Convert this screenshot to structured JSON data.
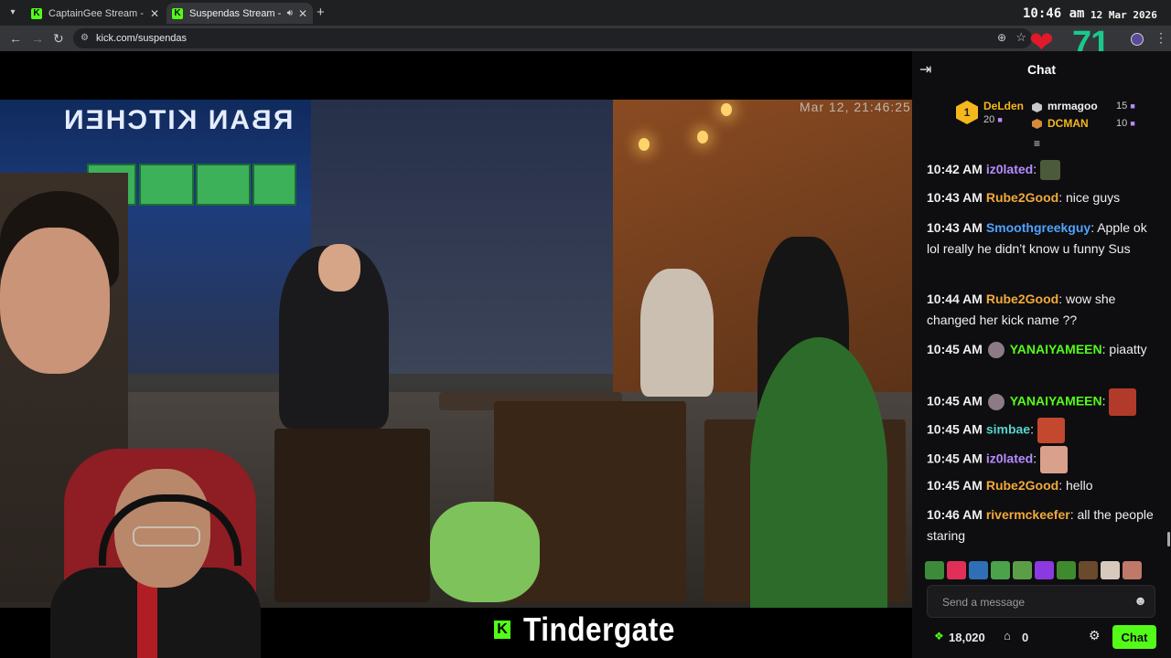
{
  "browser": {
    "tabs": [
      {
        "title": "CaptainGee Stream - Watch Live",
        "active": false
      },
      {
        "title": "Suspendas Stream - Watch Live",
        "active": true
      }
    ],
    "url": "kick.com/suspendas",
    "clock": "10:46 am",
    "date": "12 Mar 2026",
    "heart_value": "71"
  },
  "video": {
    "overlay_timestamp": "Mar 12, 21:46:25",
    "storefront_sign": "RBAN KITCHEN",
    "stream_title": "Tindergate",
    "brand_mark": "K"
  },
  "chat": {
    "title": "Chat",
    "leaderboard": {
      "first": {
        "rank": "1",
        "name": "DeLden",
        "points": "20"
      },
      "second": {
        "name": "mrmagoo",
        "points": "15"
      },
      "third": {
        "name": "DCMAN",
        "points": "10"
      }
    },
    "messages": [
      {
        "time": "10:42 AM",
        "user": "iz0lated",
        "user_color": "#b48cff",
        "text": "",
        "emote": true
      },
      {
        "time": "10:43 AM",
        "user": "Rube2Good",
        "user_color": "#f2a93b",
        "text": "nice guys"
      },
      {
        "time": "10:43 AM",
        "user": "Smoothgreekguy",
        "user_color": "#4ea3ff",
        "text": "Apple ok lol really he didn’t know u funny Sus"
      },
      {
        "time": "10:44 AM",
        "user": "Rube2Good",
        "user_color": "#f2a93b",
        "text": "wow she changed her kick name ??"
      },
      {
        "time": "10:45 AM",
        "user": "YANAIYAMEEN",
        "user_color": "#53fc18",
        "text": "piaatty"
      },
      {
        "time": "10:45 AM",
        "user": "YANAIYAMEEN",
        "user_color": "#53fc18",
        "text": "",
        "emote": true
      },
      {
        "time": "10:45 AM",
        "user": "simbae",
        "user_color": "#59d3c9",
        "text": "",
        "emote": true
      },
      {
        "time": "10:45 AM",
        "user": "iz0lated",
        "user_color": "#b48cff",
        "text": "",
        "emote": true
      },
      {
        "time": "10:45 AM",
        "user": "Rube2Good",
        "user_color": "#f2a93b",
        "text": "hello"
      },
      {
        "time": "10:46 AM",
        "user": "rivermckeefer",
        "user_color": "#f2a93b",
        "text": "all the people staring"
      }
    ],
    "input_placeholder": "Send a message",
    "points": "18,020",
    "store_count": "0",
    "send_button": "Chat"
  },
  "colors": {
    "kick_green": "#53fc18",
    "gold": "#f5b81c",
    "chat_bg": "#0e0e10",
    "heart_red": "#e01a2a",
    "heart_number": "#19c98b"
  },
  "icons": [
    "tab-list-icon",
    "kick-favicon",
    "speaker-icon",
    "close-icon",
    "new-tab-icon",
    "back-icon",
    "forward-icon",
    "reload-icon",
    "site-info-icon",
    "zoom-icon",
    "star-icon",
    "menu-icon",
    "heart-icon",
    "collapse-chat-icon",
    "gift-icon",
    "pin-icon",
    "emoji-icon",
    "points-icon",
    "store-icon",
    "gear-icon"
  ]
}
